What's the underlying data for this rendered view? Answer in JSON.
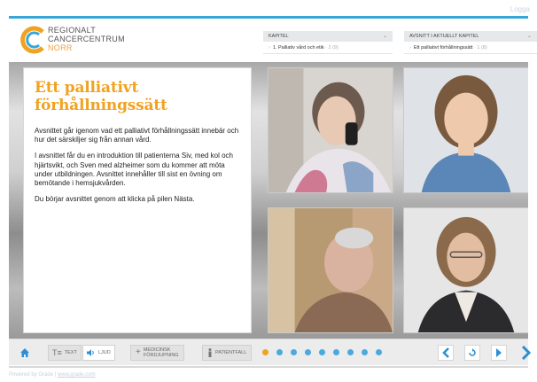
{
  "app": {
    "login_label": "Logga"
  },
  "logo": {
    "line1": "REGIONALT",
    "line2": "CANCERCENTRUM",
    "line3": "NORR"
  },
  "selectors": {
    "chapter": {
      "label": "KAPITEL",
      "value": "1. Palliativ vård och etik",
      "count": "· 2 (9)"
    },
    "section": {
      "label": "AVSNITT I AKTUELLT KAPITEL",
      "value": "Ett palliativt förhållningssätt",
      "count": "· 1 (8)"
    }
  },
  "content": {
    "title": "Ett palliativt förhållningssätt",
    "p1": "Avsnittet går igenom vad ett palliativt förhållningssätt innebär och hur det särskiljer sig från annan vård.",
    "p2": "I avsnittet får du en introduktion till patienterna Siv, med kol och hjärtsvikt, och Sven med alzheimer som du kommer att möta under utbildningen. Avsnittet innehåller till sist en övning om bemötande i hemsjukvården.",
    "p3": "Du börjar avsnittet genom att klicka på pilen Nästa."
  },
  "toolbar": {
    "text_label": "TEXT",
    "audio_label": "LJUD",
    "medicine_label_1": "MEDICINSK",
    "medicine_label_2": "FÖRDJUPNING",
    "patient_label": "PATIENTFALL"
  },
  "progress": {
    "total": 9,
    "current": 1
  },
  "footer": {
    "prefix": "Powered by Grade | ",
    "link": "www.grade.com"
  },
  "colors": {
    "accent": "#f0a221",
    "blue": "#3aa6d8"
  },
  "icons": [
    "home-icon",
    "text-icon",
    "speaker-icon",
    "plus-icon",
    "person-icon",
    "chevron-left-icon",
    "replay-icon",
    "play-icon",
    "chevron-right-icon"
  ]
}
